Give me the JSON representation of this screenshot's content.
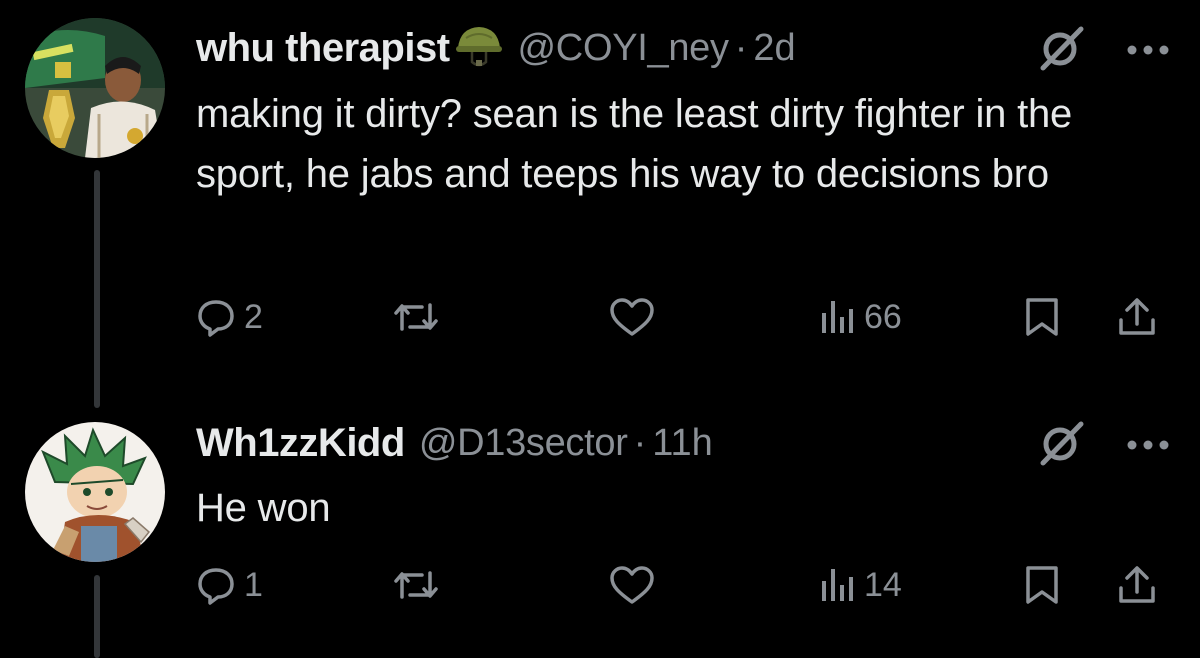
{
  "colors": {
    "background": "#000000",
    "text_primary": "#e7e9ea",
    "text_secondary": "#8b9096",
    "thread_line": "#333639"
  },
  "tweets": [
    {
      "display_name": "whu therapist",
      "name_emoji": "military-helmet-icon",
      "handle": "@COYI_ney",
      "separator": "·",
      "time": "2d",
      "text": "making it dirty? sean is the least dirty fighter in the sport, he jabs and teeps his way to decisions bro",
      "replies": "2",
      "views": "66",
      "icons": [
        "avatar",
        "grok-icon",
        "more-icon",
        "reply-icon",
        "retweet-icon",
        "like-icon",
        "views-icon",
        "bookmark-icon",
        "share-icon"
      ]
    },
    {
      "display_name": "Wh1zzKidd",
      "handle": "@D13sector",
      "separator": "·",
      "time": "11h",
      "text": "He won",
      "replies": "1",
      "views": "14",
      "icons": [
        "avatar",
        "grok-icon",
        "more-icon",
        "reply-icon",
        "retweet-icon",
        "like-icon",
        "views-icon",
        "bookmark-icon",
        "share-icon"
      ]
    }
  ]
}
